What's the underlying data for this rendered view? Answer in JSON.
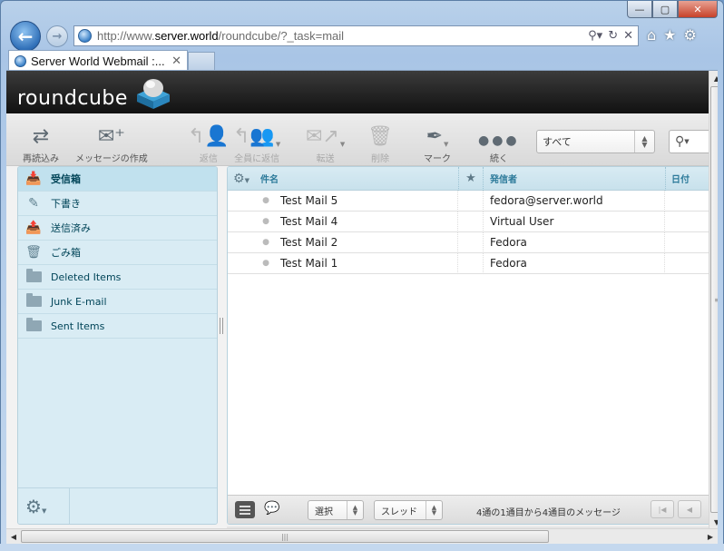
{
  "browser": {
    "url_prefix": "http://www.",
    "url_domain": "server.world",
    "url_path": "/roundcube/?_task=mail",
    "tab_title": "Server World Webmail :...",
    "window_controls": {
      "minimize": "—",
      "maximize": "▢",
      "close": "✕"
    }
  },
  "app": {
    "logo_text": "roundcube"
  },
  "toolbar": {
    "reload": "再読込み",
    "compose": "メッセージの作成",
    "reply": "返信",
    "reply_all": "全員に返信",
    "forward": "転送",
    "delete": "削除",
    "mark": "マーク",
    "more": "続く",
    "filter_value": "すべて"
  },
  "folders": [
    {
      "label": "受信箱",
      "icon": "inbox-icon",
      "selected": true
    },
    {
      "label": "下書き",
      "icon": "pencil-icon",
      "selected": false
    },
    {
      "label": "送信済み",
      "icon": "sent-icon",
      "selected": false
    },
    {
      "label": "ごみ箱",
      "icon": "trash-icon",
      "selected": false
    },
    {
      "label": "Deleted Items",
      "icon": "folder-icon",
      "selected": false
    },
    {
      "label": "Junk E-mail",
      "icon": "folder-icon",
      "selected": false
    },
    {
      "label": "Sent Items",
      "icon": "folder-icon",
      "selected": false
    }
  ],
  "message_list": {
    "columns": {
      "subject": "件名",
      "from": "発信者",
      "date": "日付"
    },
    "rows": [
      {
        "subject": "Test Mail 5",
        "from": "fedora@server.world"
      },
      {
        "subject": "Test Mail 4",
        "from": "Virtual User"
      },
      {
        "subject": "Test Mail 2",
        "from": "Fedora"
      },
      {
        "subject": "Test Mail 1",
        "from": "Fedora"
      }
    ],
    "footer": {
      "select_label": "選択",
      "threads_label": "スレッド",
      "count_text": "4通の1通目から4通目のメッセージ"
    }
  },
  "colors": {
    "folder_bg": "#d9ecf4",
    "header_bg": "#111111",
    "accent_text": "#2c7a9a"
  }
}
